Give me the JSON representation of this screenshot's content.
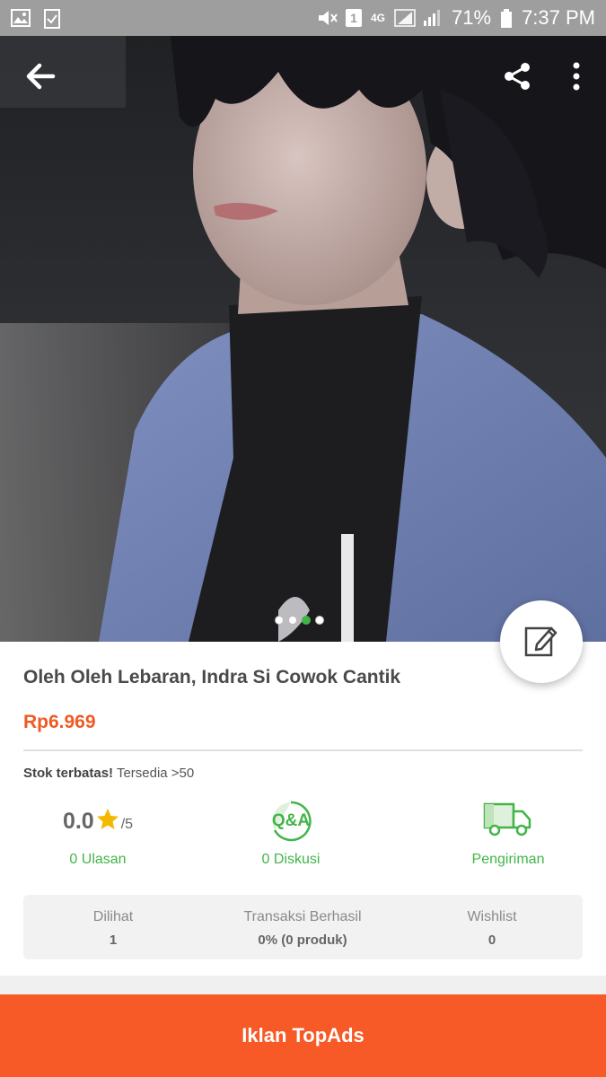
{
  "status_bar": {
    "network": "4G",
    "sim_slot": "1",
    "battery_percent": "71%",
    "time": "7:37 PM",
    "icons": [
      "gallery-icon",
      "checklist-icon",
      "mute-icon",
      "sim-icon",
      "signal-icon",
      "battery-icon"
    ]
  },
  "top_actions": {
    "icons": [
      "back-arrow-icon",
      "share-icon",
      "more-vertical-icon"
    ]
  },
  "carousel": {
    "dot_count": 4,
    "active_index": 2,
    "active_color": "#42b549"
  },
  "product": {
    "title": "Oleh Oleh Lebaran, Indra Si Cowok Cantik",
    "price": "Rp6.969",
    "stock_label": "Stok terbatas!",
    "stock_text": "Tersedia >50"
  },
  "stats": {
    "rating_value": "0.0",
    "rating_max": "/5",
    "reviews": "0 Ulasan",
    "qa_icon_text": "Q&A",
    "discussions": "0 Diskusi",
    "shipping": "Pengiriman"
  },
  "info": {
    "viewed_label": "Dilihat",
    "viewed_value": "1",
    "transactions_label": "Transaksi Berhasil",
    "transactions_value": "0% (0 produk)",
    "wishlist_label": "Wishlist",
    "wishlist_value": "0"
  },
  "bottom": {
    "button_label": "Iklan TopAds"
  },
  "colors": {
    "accent_green": "#42b549",
    "price_orange": "#ee5a24",
    "cta_orange": "#f75a26",
    "star_yellow": "#f5b800"
  }
}
